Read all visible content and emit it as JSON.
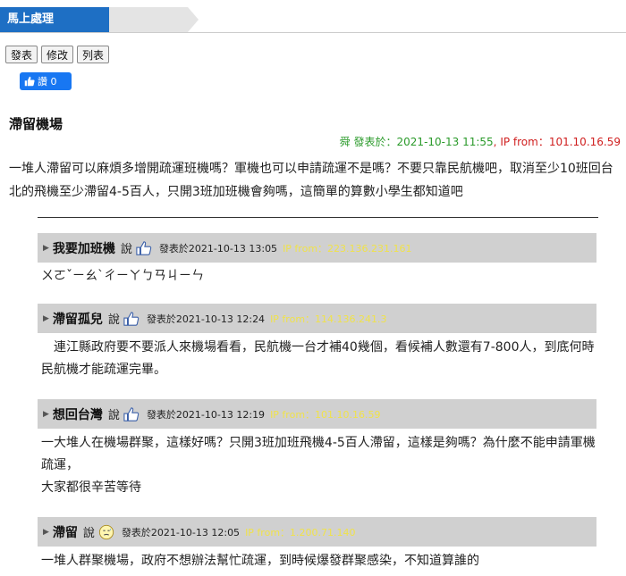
{
  "breadcrumb": {
    "current": "馬上處理"
  },
  "toolbar": {
    "post": "發表",
    "edit": "修改",
    "list": "列表"
  },
  "like": {
    "label": "讚 0"
  },
  "post": {
    "title": "滯留機場",
    "author": "舜",
    "time_label": "發表於：2021-10-13 11:55",
    "ip_label": "IP from：101.10.16.59",
    "body": "一堆人滯留可以麻煩多增開疏運班機嗎？軍機也可以申請疏運不是嗎？不要只靠民航機吧，取消至少10班回台北的飛機至少滯留4-5百人，只開3班加班機會夠嗎，這簡單的算數小學生都知道吧"
  },
  "replies": [
    {
      "name": "我要加班機",
      "said": "說",
      "emotion": "thumbs-up-icon",
      "time_label": "發表於2021-10-13 13:05",
      "ip_label": "IP from：223.136.231.161",
      "body": "ㄨㄛˇㄧㄠˋㄔㄧㄚㄅㄢㄐㄧㄣ"
    },
    {
      "name": "滯留孤兒",
      "said": "說",
      "emotion": "thumbs-up-icon",
      "time_label": "發表於2021-10-13 12:24",
      "ip_label": "IP from：114.136.241.3",
      "body": "　連江縣政府要不要派人來機場看看，民航機一台才補40幾個，看候補人數還有7-800人，到底何時民航機才能疏運完畢。"
    },
    {
      "name": "想回台灣",
      "said": "說",
      "emotion": "thumbs-up-icon",
      "time_label": "發表於2021-10-13 12:19",
      "ip_label": "IP from：101.10.16.59",
      "body_line1": "一大堆人在機場群聚，這樣好嗎？只開3班加班飛機4-5百人滯留，這樣是夠嗎？為什麼不能申請軍機疏運，",
      "body_line2": "大家都很辛苦等待"
    },
    {
      "name": "滯留",
      "said": "說",
      "emotion": "sweat-face-icon",
      "time_label": "發表於2021-10-13 12:05",
      "ip_label": "IP from：1.200.71.140",
      "body": "一堆人群聚機場，政府不想辦法幫忙疏運，到時候爆發群聚感染，不知道算誰的"
    }
  ]
}
